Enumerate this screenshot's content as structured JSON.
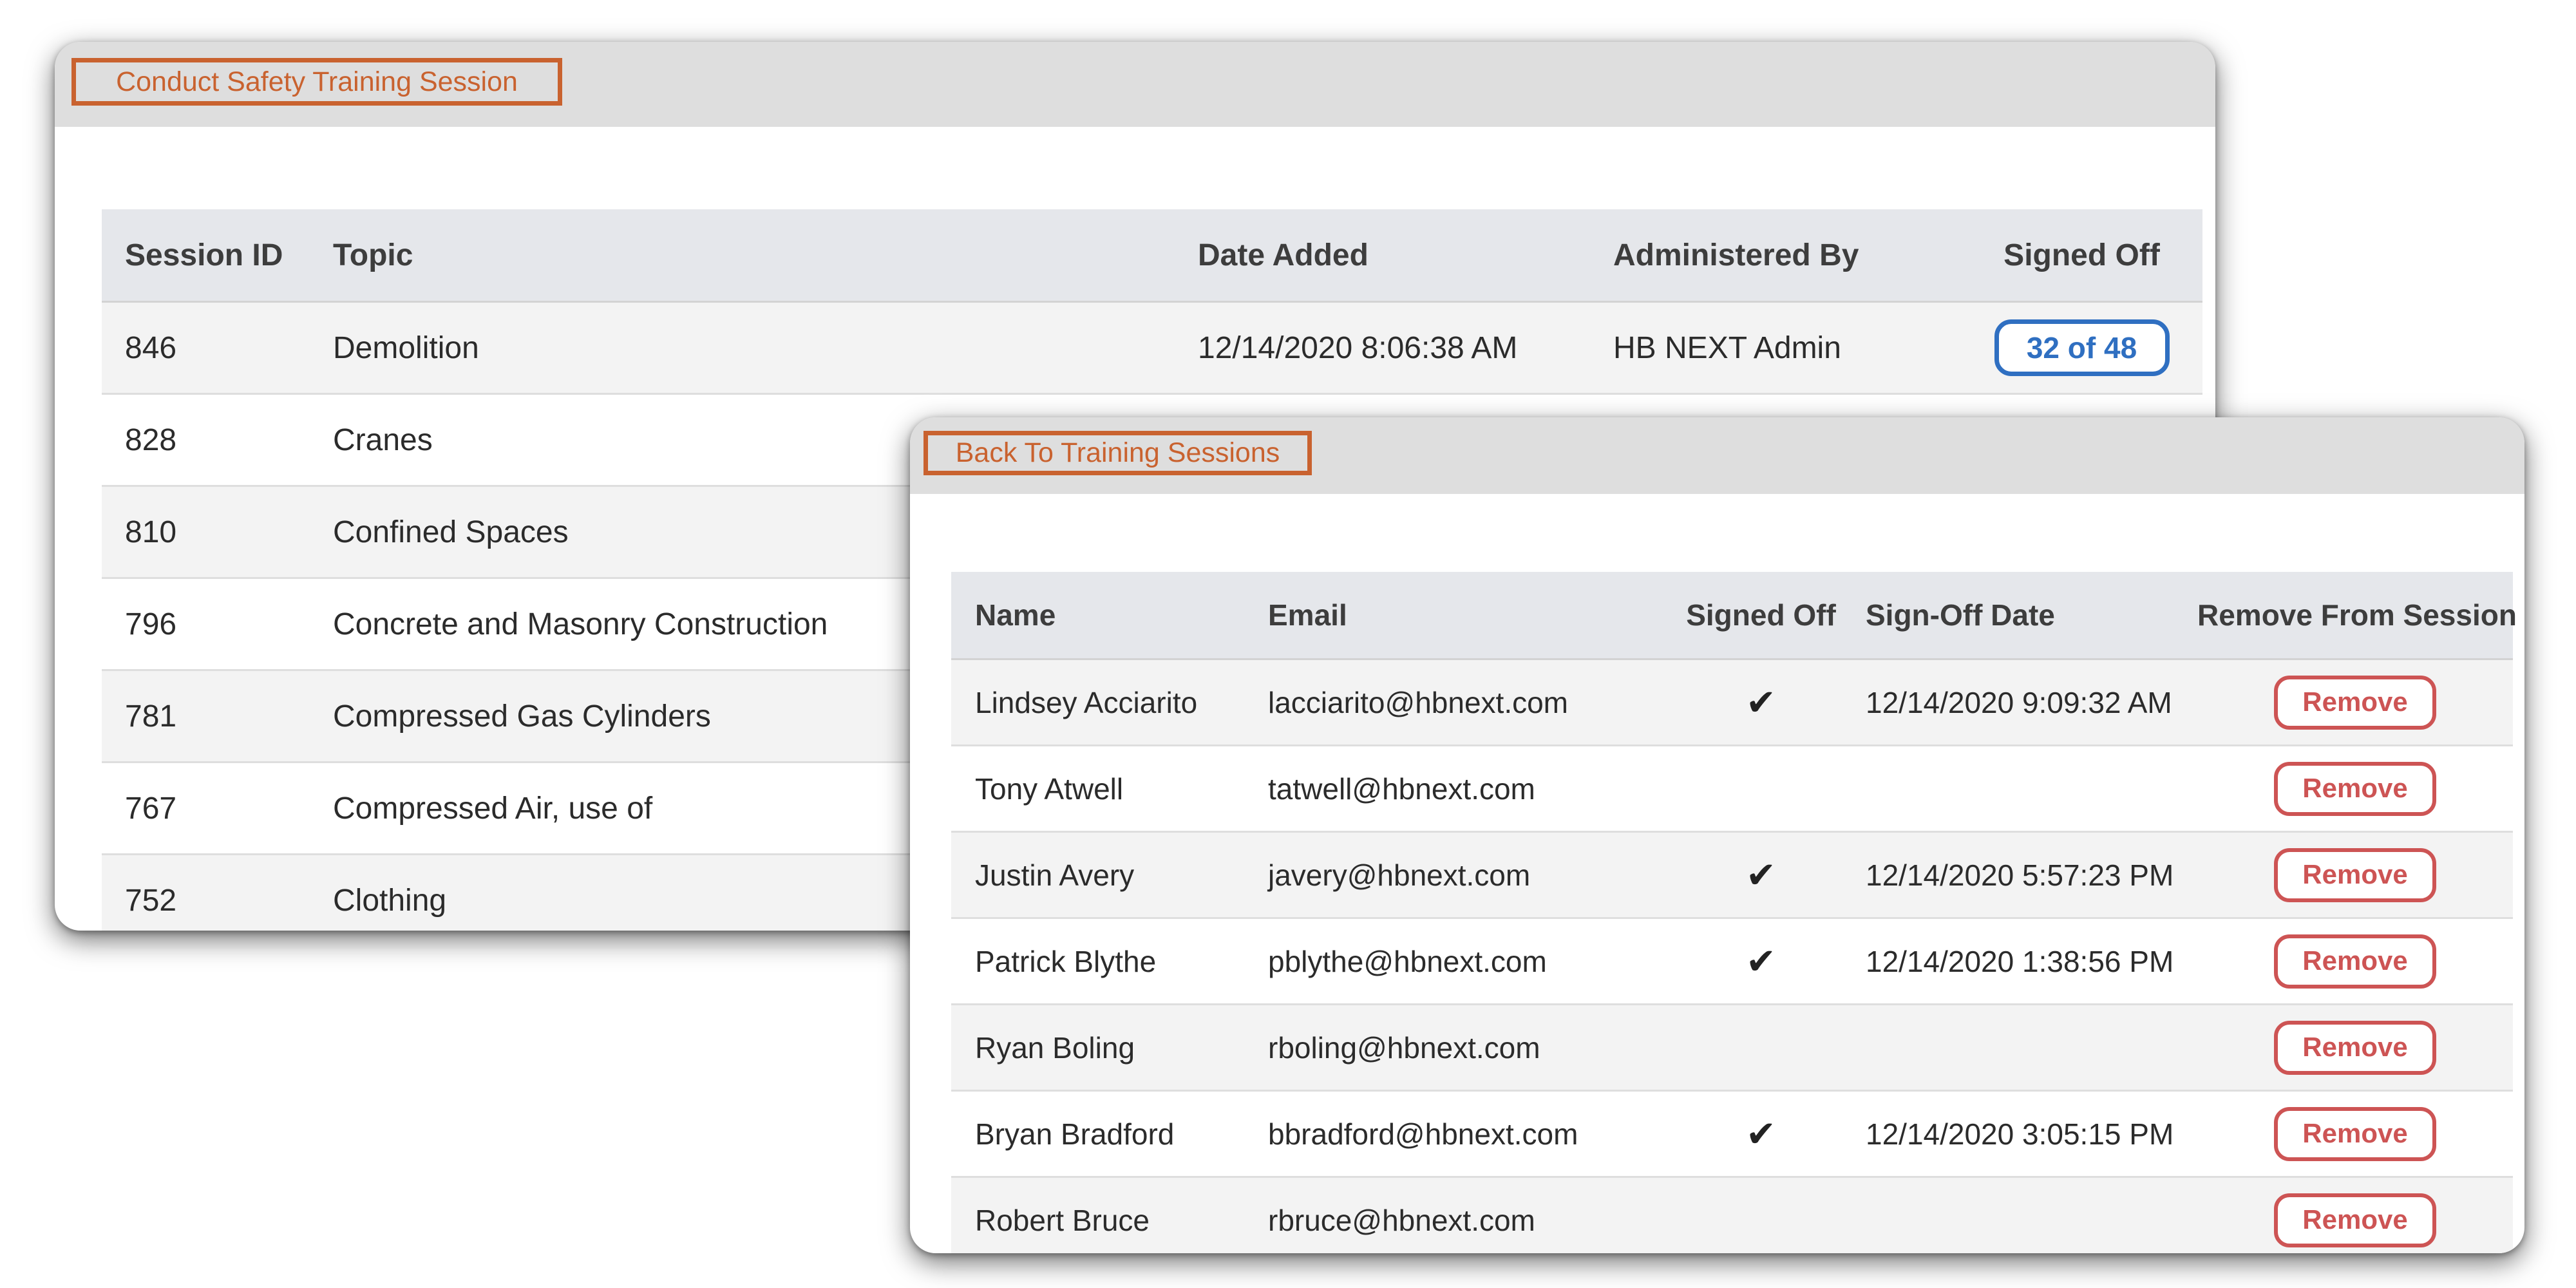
{
  "main_panel": {
    "header_button": "Conduct Safety Training Session",
    "columns": [
      "Session ID",
      "Topic",
      "Date Added",
      "Administered By",
      "Signed Off"
    ],
    "rows": [
      {
        "id": "846",
        "topic": "Demolition",
        "date_added": "12/14/2020 8:06:38 AM",
        "administered_by": "HB NEXT Admin",
        "signed_off": "32 of 48"
      },
      {
        "id": "828",
        "topic": "Cranes",
        "date_added": "",
        "administered_by": "",
        "signed_off": ""
      },
      {
        "id": "810",
        "topic": "Confined Spaces",
        "date_added": "",
        "administered_by": "",
        "signed_off": ""
      },
      {
        "id": "796",
        "topic": "Concrete and Masonry Construction",
        "date_added": "",
        "administered_by": "",
        "signed_off": ""
      },
      {
        "id": "781",
        "topic": "Compressed Gas Cylinders",
        "date_added": "",
        "administered_by": "",
        "signed_off": ""
      },
      {
        "id": "767",
        "topic": "Compressed Air, use of",
        "date_added": "",
        "administered_by": "",
        "signed_off": ""
      },
      {
        "id": "752",
        "topic": "Clothing",
        "date_added": "",
        "administered_by": "",
        "signed_off": ""
      }
    ]
  },
  "detail_panel": {
    "header_button": "Back To Training Sessions",
    "columns": [
      "Name",
      "Email",
      "Signed Off",
      "Sign-Off Date",
      "Remove From Session"
    ],
    "check_glyph": "✔",
    "remove_label": "Remove",
    "rows": [
      {
        "name": "Lindsey Acciarito",
        "email": "lacciarito@hbnext.com",
        "signed": true,
        "date": "12/14/2020 9:09:32 AM"
      },
      {
        "name": "Tony Atwell",
        "email": "tatwell@hbnext.com",
        "signed": false,
        "date": ""
      },
      {
        "name": "Justin Avery",
        "email": "javery@hbnext.com",
        "signed": true,
        "date": "12/14/2020 5:57:23 PM"
      },
      {
        "name": "Patrick Blythe",
        "email": "pblythe@hbnext.com",
        "signed": true,
        "date": "12/14/2020 1:38:56 PM"
      },
      {
        "name": "Ryan Boling",
        "email": "rboling@hbnext.com",
        "signed": false,
        "date": ""
      },
      {
        "name": "Bryan Bradford",
        "email": "bbradford@hbnext.com",
        "signed": true,
        "date": "12/14/2020 3:05:15 PM"
      },
      {
        "name": "Robert  Bruce",
        "email": "rbruce@hbnext.com",
        "signed": false,
        "date": ""
      }
    ]
  },
  "colors": {
    "header_button": "#c9622f",
    "signed_badge": "#2f6fc1",
    "remove_button": "#cd5454",
    "header_bar": "#dedede"
  }
}
